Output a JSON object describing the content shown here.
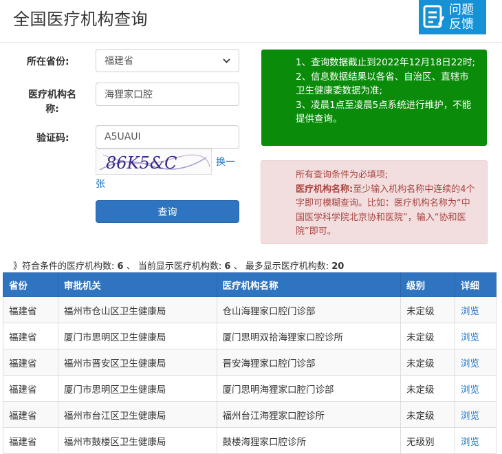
{
  "header": {
    "title": "全国医疗机构查询",
    "feedback_line1": "问题",
    "feedback_line2": "反馈"
  },
  "form": {
    "province_label": "所在省份:",
    "province_value": "福建省",
    "name_label_line1": "医疗机构名",
    "name_label_line2": "称:",
    "name_value": "海狸家口腔",
    "captcha_label": "验证码:",
    "captcha_value": "A5UAUI",
    "captcha_chars": "86K5&C",
    "swap_line1": "换一",
    "swap_line2": "张",
    "submit_label": "查询"
  },
  "notice_green": {
    "line1": "1、查询数据截止到2022年12月18日22时;",
    "line2": "2、信息数据结果以各省、自治区、直辖市卫生健康委数据为准;",
    "line3": "3、凌晨1点至凌晨5点系统进行维护，不能提供查询。"
  },
  "notice_red": {
    "line1": "所有查询条件为必填项;",
    "strong": "医疗机构名称:",
    "rest": "至少输入机构名称中连续的4个字即可模糊查询。比如：医疗机构名称为“中国医学科学院北京协和医院”，输入“协和医院”即可。"
  },
  "summary": {
    "prefix": "》符合条件的医疗机构数:",
    "matched": "6",
    "mid": "、 当前显示医疗机构数:",
    "shown": "6",
    "mid2": "、 最多显示医疗机构数:",
    "max": "20"
  },
  "table": {
    "headers": [
      "省份",
      "审批机关",
      "医疗机构名称",
      "级别",
      "详细"
    ],
    "rows": [
      [
        "福建省",
        "福州市仓山区卫生健康局",
        "仓山海狸家口腔门诊部",
        "未定级",
        "浏览"
      ],
      [
        "福建省",
        "厦门市思明区卫生健康局",
        "厦门思明双拾海狸家口腔诊所",
        "未定级",
        "浏览"
      ],
      [
        "福建省",
        "福州市晋安区卫生健康局",
        "晋安海狸家口腔门诊部",
        "未定级",
        "浏览"
      ],
      [
        "福建省",
        "厦门市思明区卫生健康局",
        "厦门思明海狸家口腔门诊部",
        "未定级",
        "浏览"
      ],
      [
        "福建省",
        "福州市台江区卫生健康局",
        "福州台江海狸家口腔诊所",
        "未定级",
        "浏览"
      ],
      [
        "福建省",
        "福州市鼓楼区卫生健康局",
        "鼓楼海狸家口腔诊所",
        "无级别",
        "浏览"
      ]
    ]
  },
  "colors": {
    "primary": "#2f74c0",
    "notice_green": "#0a8c0a",
    "notice_red_bg": "#f2dede",
    "notice_red_text": "#a94442",
    "feedback_bg": "#1591d6"
  }
}
